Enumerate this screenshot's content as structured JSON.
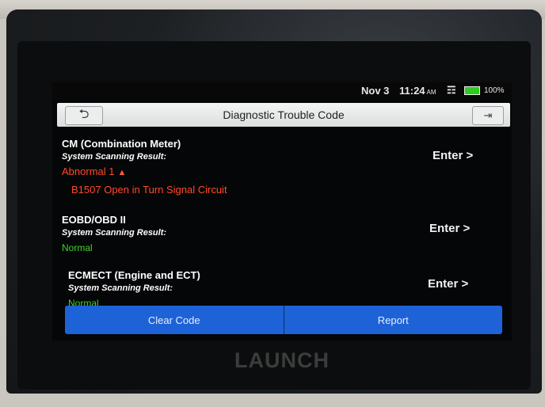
{
  "status_bar": {
    "date": "Nov 3",
    "time": "11:24",
    "ampm": "AM",
    "battery": "100%"
  },
  "header": {
    "title": "Diagnostic Trouble Code"
  },
  "systems": [
    {
      "name": "CM (Combination Meter)",
      "scan_label": "System Scanning Result:",
      "result": "Abnormal 1",
      "dtc": "B1507 Open in Turn Signal Circuit",
      "enter_label": "Enter >"
    },
    {
      "name": "EOBD/OBD II",
      "scan_label": "System Scanning Result:",
      "result": "Normal",
      "enter_label": "Enter >"
    },
    {
      "name": "ECMECT (Engine and ECT)",
      "scan_label": "System Scanning Result:",
      "result": "Normal",
      "enter_label": "Enter >"
    }
  ],
  "footer": {
    "clear_code": "Clear Code",
    "report": "Report"
  },
  "device": {
    "brand": "LAUNCH"
  },
  "icons": {
    "back": "back-arrow-icon",
    "exit": "exit-icon",
    "wifi": "wifi-icon",
    "battery": "battery-icon",
    "abnormal": "triangle-up-icon"
  },
  "colors": {
    "abnormal": "#ff4a2a",
    "normal": "#3fd42a",
    "button_bar": "#1e62d8"
  }
}
